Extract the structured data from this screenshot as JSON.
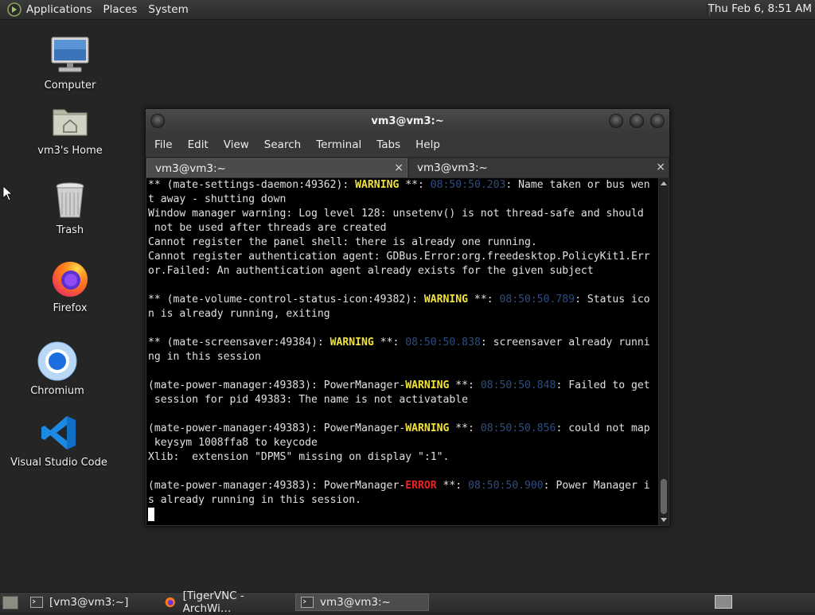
{
  "top_panel": {
    "menus": [
      "Applications",
      "Places",
      "System"
    ],
    "clock": "Thu Feb  6,  8:51 AM"
  },
  "desktop_icons": [
    {
      "label": "Computer",
      "icon": "computer-icon"
    },
    {
      "label": "vm3's Home",
      "icon": "home-folder-icon"
    },
    {
      "label": "Trash",
      "icon": "trash-icon"
    },
    {
      "label": "Firefox",
      "icon": "firefox-icon"
    },
    {
      "label": "Chromium",
      "icon": "chromium-icon"
    },
    {
      "label": "Visual Studio Code",
      "icon": "vscode-icon"
    }
  ],
  "terminal": {
    "title": "vm3@vm3:~",
    "menus": [
      "File",
      "Edit",
      "View",
      "Search",
      "Terminal",
      "Tabs",
      "Help"
    ],
    "tabs": [
      {
        "label": "vm3@vm3:~",
        "active": true
      },
      {
        "label": "vm3@vm3:~",
        "active": false
      }
    ],
    "close_glyph": "×",
    "lines": [
      [
        {
          "t": "** (mate-settings-daemon:49362): "
        },
        {
          "t": "WARNING",
          "c": "warn"
        },
        {
          "t": " **: "
        },
        {
          "t": "08:50:50.203",
          "c": "ts"
        },
        {
          "t": ": Name taken or bus wen"
        }
      ],
      [
        {
          "t": "t away - shutting down"
        }
      ],
      [
        {
          "t": "Window manager warning: Log level 128: unsetenv() is not thread-safe and should"
        }
      ],
      [
        {
          "t": " not be used after threads are created"
        }
      ],
      [
        {
          "t": "Cannot register the panel shell: there is already one running."
        }
      ],
      [
        {
          "t": "Cannot register authentication agent: GDBus.Error:org.freedesktop.PolicyKit1.Err"
        }
      ],
      [
        {
          "t": "or.Failed: An authentication agent already exists for the given subject"
        }
      ],
      [],
      [
        {
          "t": "** (mate-volume-control-status-icon:49382): "
        },
        {
          "t": "WARNING",
          "c": "warn"
        },
        {
          "t": " **: "
        },
        {
          "t": "08:50:50.789",
          "c": "ts"
        },
        {
          "t": ": Status ico"
        }
      ],
      [
        {
          "t": "n is already running, exiting"
        }
      ],
      [],
      [
        {
          "t": "** (mate-screensaver:49384): "
        },
        {
          "t": "WARNING",
          "c": "warn"
        },
        {
          "t": " **: "
        },
        {
          "t": "08:50:50.838",
          "c": "ts"
        },
        {
          "t": ": screensaver already runni"
        }
      ],
      [
        {
          "t": "ng in this session"
        }
      ],
      [],
      [
        {
          "t": "(mate-power-manager:49383): PowerManager-"
        },
        {
          "t": "WARNING",
          "c": "warn"
        },
        {
          "t": " **: "
        },
        {
          "t": "08:50:50.848",
          "c": "ts"
        },
        {
          "t": ": Failed to get"
        }
      ],
      [
        {
          "t": " session for pid 49383: The name is not activatable"
        }
      ],
      [],
      [
        {
          "t": "(mate-power-manager:49383): PowerManager-"
        },
        {
          "t": "WARNING",
          "c": "warn"
        },
        {
          "t": " **: "
        },
        {
          "t": "08:50:50.856",
          "c": "ts"
        },
        {
          "t": ": could not map"
        }
      ],
      [
        {
          "t": " keysym 1008ffa8 to keycode"
        }
      ],
      [
        {
          "t": "Xlib:  extension \"DPMS\" missing on display \":1\"."
        }
      ],
      [],
      [
        {
          "t": "(mate-power-manager:49383): PowerManager-"
        },
        {
          "t": "ERROR",
          "c": "err"
        },
        {
          "t": " **: "
        },
        {
          "t": "08:50:50.900",
          "c": "ts"
        },
        {
          "t": ": Power Manager i"
        }
      ],
      [
        {
          "t": "s already running in this session."
        }
      ]
    ]
  },
  "taskbar": {
    "items": [
      {
        "label": "[vm3@vm3:~]",
        "icon": "terminal-icon",
        "active": false
      },
      {
        "label": "[TigerVNC - ArchWi…",
        "icon": "firefox-icon",
        "active": false
      },
      {
        "label": "vm3@vm3:~",
        "icon": "terminal-icon",
        "active": true
      }
    ]
  },
  "colors": {
    "warning": "#f2e33a",
    "error": "#ea2424",
    "timestamp": "#2e4d7f",
    "terminal_bg": "#000000",
    "desktop_bg": "#252525"
  }
}
